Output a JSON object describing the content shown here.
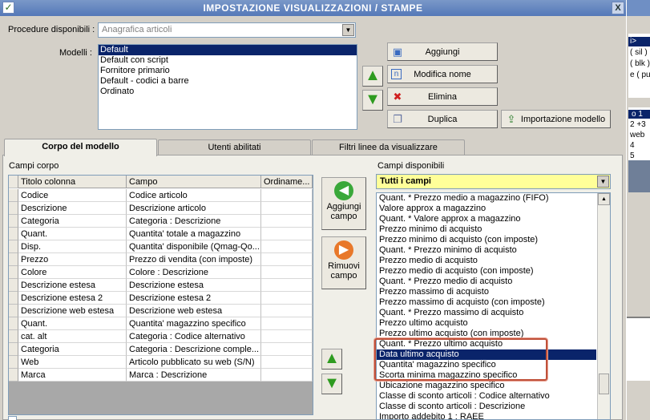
{
  "window": {
    "title": "IMPOSTAZIONE VISUALIZZAZIONI / STAMPE"
  },
  "procedure": {
    "label": "Procedure disponibili :",
    "value": "Anagrafica articoli"
  },
  "modelli": {
    "label": "Modelli :",
    "items": [
      "Default",
      "Default con script",
      "Fornitore primario",
      "Default - codici a barre",
      "Ordinato"
    ],
    "selected": "Default"
  },
  "actions": {
    "add": "Aggiungi",
    "rename": "Modifica nome",
    "delete": "Elimina",
    "duplicate": "Duplica",
    "import": "Importazione modello"
  },
  "tabs": [
    "Corpo del modello",
    "Utenti abilitati",
    "Filtri linee da visualizzare"
  ],
  "campi_corpo": {
    "label": "Campi corpo",
    "headers": [
      "Titolo colonna",
      "Campo",
      "Ordiname..."
    ],
    "rows": [
      [
        "Codice",
        "Codice articolo",
        ""
      ],
      [
        "Descrizione",
        "Descrizione articolo",
        ""
      ],
      [
        "Categoria",
        "Categoria : Descrizione",
        ""
      ],
      [
        "Quant.",
        "Quantita' totale a magazzino",
        ""
      ],
      [
        "Disp.",
        "Quantita' disponibile (Qmag-Qo...",
        ""
      ],
      [
        "Prezzo",
        "Prezzo di vendita (con imposte)",
        ""
      ],
      [
        "Colore",
        "Colore : Descrizione",
        ""
      ],
      [
        "Descrizione estesa",
        "Descrizione estesa",
        ""
      ],
      [
        "Descrizione estesa 2",
        "Descrizione estesa 2",
        ""
      ],
      [
        "Descrizione web estesa",
        "Descrizione web estesa",
        ""
      ],
      [
        "Quant.",
        "Quantita' magazzino specifico",
        ""
      ],
      [
        "cat. alt",
        "Categoria : Codice alternativo",
        ""
      ],
      [
        "Categoria",
        "Categoria : Descrizione comple...",
        ""
      ],
      [
        "Web",
        "Articolo pubblicato su web (S/N)",
        ""
      ],
      [
        "Marca",
        "Marca : Descrizione",
        ""
      ]
    ]
  },
  "middle": {
    "add_field": "Aggiungi\ncampo",
    "remove_field": "Rimuovi\ncampo"
  },
  "campi_disponibili": {
    "label": "Campi disponibili",
    "filter": "Tutti i campi",
    "items": [
      "Quant. * Prezzo medio a magazzino (FIFO)",
      "Valore approx a magazzino",
      "Quant. * Valore approx a magazzino",
      "Prezzo minimo di acquisto",
      "Prezzo minimo di acquisto (con imposte)",
      "Quant. * Prezzo minimo di acquisto",
      "Prezzo medio di acquisto",
      "Prezzo medio di acquisto (con imposte)",
      "Quant. * Prezzo medio di acquisto",
      "Prezzo massimo di acquisto",
      "Prezzo massimo di acquisto (con imposte)",
      "Quant. * Prezzo massimo di acquisto",
      "Prezzo ultimo acquisto",
      "Prezzo ultimo acquisto (con imposte)",
      "Quant. * Prezzo ultimo acquisto",
      "Data ultimo acquisto",
      "Quantita' magazzino specifico",
      "Scorta minima magazzino specifico",
      "Ubicazione magazzino specifico",
      "Classe di sconto articoli : Codice alternativo",
      "Classe di sconto articoli : Descrizione",
      "Importo addebito 1 : RAEE"
    ],
    "selected": "Data ultimo acquisto"
  },
  "right_panel": {
    "lines": [
      "i>",
      "( sil )",
      "( blk )",
      "e ( pu",
      "o 1",
      "2 +3",
      "web",
      "4",
      "5"
    ]
  },
  "colors": {
    "accent": "#0a246a",
    "highlight_box": "#c0513a",
    "filter_bg": "#ffff99"
  }
}
